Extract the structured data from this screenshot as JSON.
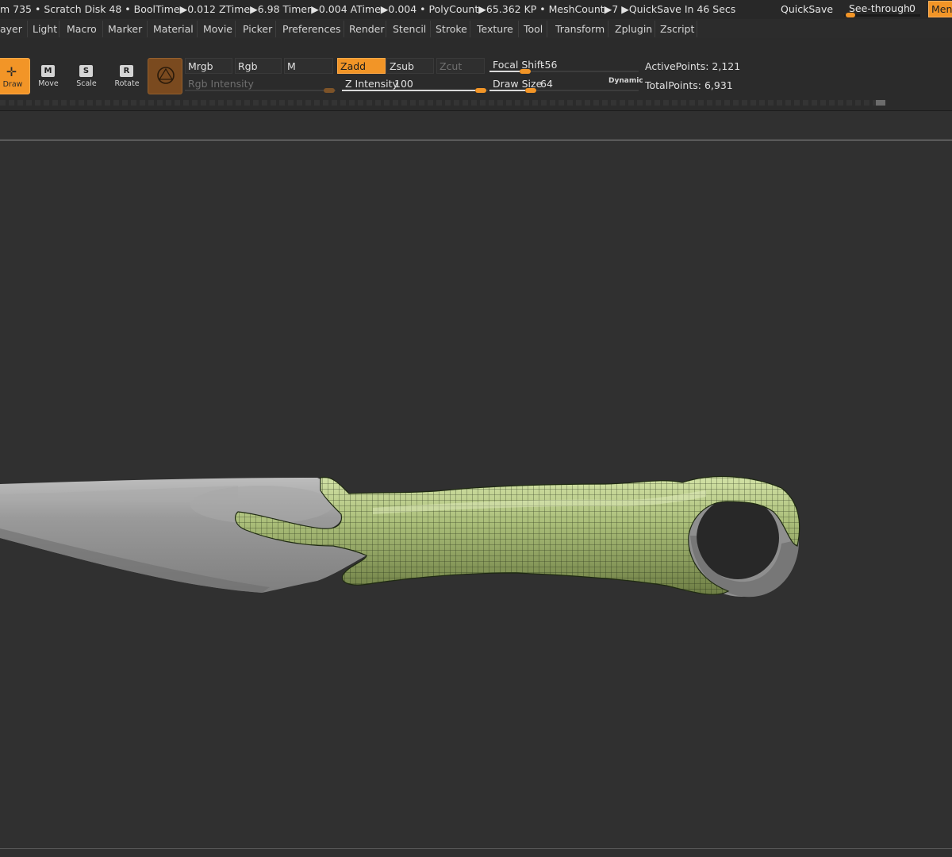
{
  "statusbar": {
    "text": "m 735 • Scratch Disk 48 •  BoolTime▶0.012 ZTime▶6.98 Timer▶0.004 ATime▶0.004 • PolyCount▶65.362 KP  • MeshCount▶7  ▶QuickSave In 46 Secs",
    "quicksave_label": "QuickSave",
    "see_through_label": "See-through",
    "see_through_value": "0",
    "menus_label": "Menus"
  },
  "menu": {
    "items": [
      "ayer",
      "Light",
      "Macro",
      "Marker",
      "Material",
      "Movie",
      "Picker",
      "Preferences",
      "Render",
      "Stencil",
      "Stroke",
      "Texture",
      "Tool",
      "Transform",
      "Zplugin",
      "Zscript"
    ]
  },
  "tools": {
    "draw": {
      "label": "Draw",
      "icon": "draw-icon"
    },
    "move": {
      "label": "Move",
      "letter": "M"
    },
    "scale": {
      "label": "Scale",
      "letter": "S"
    },
    "rotate": {
      "label": "Rotate",
      "letter": "R"
    }
  },
  "color_modes": {
    "mrgb": "Mrgb",
    "rgb": "Rgb",
    "m": "M"
  },
  "rgb_intensity": {
    "label": "Rgb Intensity",
    "value": ""
  },
  "z_modes": {
    "zadd": "Zadd",
    "zsub": "Zsub",
    "zcut": "Zcut"
  },
  "z_intensity": {
    "label": "Z Intensity",
    "value": "100"
  },
  "focal_shift": {
    "label": "Focal Shift",
    "value": "-56"
  },
  "draw_size": {
    "label": "Draw Size",
    "value": "64"
  },
  "dynamic_label": "Dynamic",
  "points": {
    "active_label": "ActivePoints:",
    "active_value": "2,121",
    "total_label": "TotalPoints:",
    "total_value": "6,931"
  },
  "colors": {
    "accent": "#f29527",
    "background": "#303030",
    "mesh_green": "#a9bd78",
    "blade_gray": "#909090"
  }
}
